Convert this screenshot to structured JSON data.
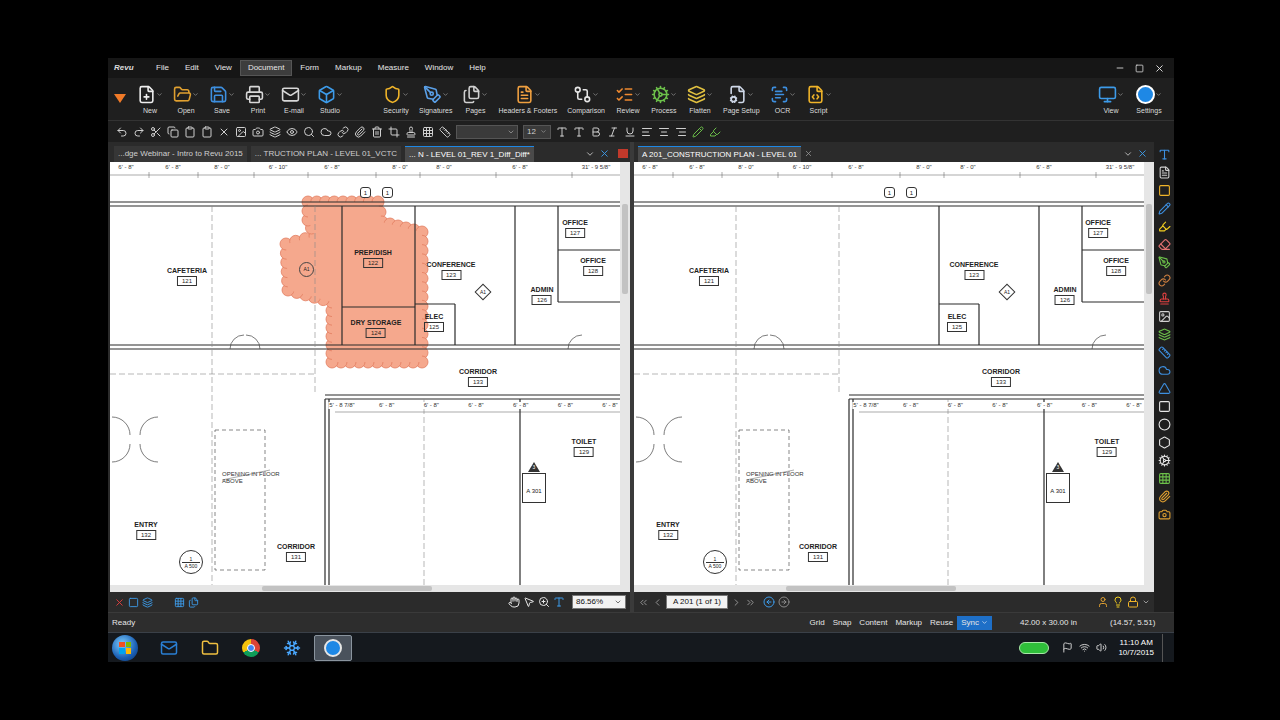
{
  "window": {
    "logo": "Revu"
  },
  "menu": [
    {
      "label": "File",
      "selected": false
    },
    {
      "label": "Edit",
      "selected": false
    },
    {
      "label": "View",
      "selected": false
    },
    {
      "label": "Document",
      "selected": true
    },
    {
      "label": "Form",
      "selected": false
    },
    {
      "label": "Markup",
      "selected": false
    },
    {
      "label": "Measure",
      "selected": false
    },
    {
      "label": "Window",
      "selected": false
    },
    {
      "label": "Help",
      "selected": false
    }
  ],
  "toolbar_groups": [
    [
      "New",
      "Open",
      "Save",
      "Print",
      "E-mail",
      "Studio"
    ],
    [
      "Security",
      "Signatures",
      "Pages",
      "Headers & Footers",
      "Comparison",
      "Review",
      "Process",
      "Flatten",
      "Page Setup",
      "OCR",
      "Script"
    ]
  ],
  "toolbar_right": [
    "View",
    "Settings"
  ],
  "format_bar": {
    "size": "12"
  },
  "left_pane": {
    "tabs": [
      {
        "label": "...dge Webinar - Intro to Revu 2015",
        "selected": false
      },
      {
        "label": "... TRUCTION PLAN - LEVEL 01_VCTC",
        "selected": false
      },
      {
        "label": "... N - LEVEL 01_REV 1_Diff_Diff*",
        "selected": true
      }
    ],
    "zoom": "86.56%",
    "plan": {
      "rooms": [
        {
          "name": "CAFETERIA",
          "number": "121"
        },
        {
          "name": "PREP/DISH",
          "number": "122"
        },
        {
          "name": "CONFERENCE",
          "number": "123"
        },
        {
          "name": "OFFICE",
          "number": "127"
        },
        {
          "name": "OFFICE",
          "number": "128"
        },
        {
          "name": "ADMIN",
          "number": "126"
        },
        {
          "name": "ELEC",
          "number": "125"
        },
        {
          "name": "DRY STORAGE",
          "number": "124"
        },
        {
          "name": "CORRIDOR",
          "number": "133"
        },
        {
          "name": "TOILET",
          "number": "129"
        },
        {
          "name": "ENTRY",
          "number": "132"
        },
        {
          "name": "CORRIDOR",
          "number": "131"
        }
      ],
      "dimensions_top": [
        "6' - 8\"",
        "6' - 8\"",
        "8' - 0\"",
        "6' - 10\"",
        "6' - 8\"",
        "8' - 0\"",
        "8' - 0\"",
        "6' - 8\"",
        "31' - 9 5/8\""
      ],
      "dimensions_corridor": [
        "5' - 8 7/8\"",
        "6' - 8\"",
        "6' - 8\"",
        "6' - 8\"",
        "6' - 8\"",
        "6' - 8\"",
        "6' - 8\""
      ],
      "grid_tags": [
        "1",
        "1"
      ],
      "keynote": "A1",
      "note": "OPENING IN FLOOR ABOVE",
      "section_tag": {
        "number": "3",
        "sheet": "A 301"
      },
      "detail_tag": {
        "number": "1",
        "sheet": "A 500"
      },
      "revision_cloud": {
        "visible": true,
        "tag": "A1"
      }
    }
  },
  "right_pane": {
    "tabs": [
      {
        "label": "A 201_CONSTRUCTION PLAN - LEVEL 01",
        "selected": true
      }
    ],
    "page": "A 201 (1 of 1)",
    "plan": {
      "rooms": [
        {
          "name": "CAFETERIA",
          "number": "121"
        },
        {
          "name": "CONFERENCE",
          "number": "123"
        },
        {
          "name": "OFFICE",
          "number": "127"
        },
        {
          "name": "OFFICE",
          "number": "128"
        },
        {
          "name": "ADMIN",
          "number": "126"
        },
        {
          "name": "ELEC",
          "number": "125"
        },
        {
          "name": "CORRIDOR",
          "number": "133"
        },
        {
          "name": "TOILET",
          "number": "129"
        },
        {
          "name": "ENTRY",
          "number": "132"
        },
        {
          "name": "CORRIDOR",
          "number": "131"
        }
      ],
      "dimensions_top": [
        "6' - 8\"",
        "6' - 8\"",
        "8' - 0\"",
        "6' - 10\"",
        "6' - 8\"",
        "8' - 0\"",
        "8' - 0\"",
        "6' - 8\"",
        "31' - 9 5/8\""
      ],
      "dimensions_corridor": [
        "5' - 8 7/8\"",
        "6' - 8\"",
        "6' - 8\"",
        "6' - 8\"",
        "6' - 8\"",
        "6' - 8\"",
        "6' - 8\""
      ],
      "grid_tags": [
        "1",
        "1"
      ],
      "keynote": "A1",
      "note": "OPENING IN FLOOR ABOVE",
      "section_tag": {
        "number": "3",
        "sheet": "A 301"
      },
      "detail_tag": {
        "number": "1",
        "sheet": "A 500"
      },
      "revision_cloud": {
        "visible": false
      }
    }
  },
  "status_bar": {
    "message": "Ready",
    "toggles": [
      {
        "label": "Grid",
        "on": false
      },
      {
        "label": "Snap",
        "on": false
      },
      {
        "label": "Content",
        "on": false
      },
      {
        "label": "Markup",
        "on": false
      },
      {
        "label": "Reuse",
        "on": false
      },
      {
        "label": "Sync",
        "on": true
      }
    ],
    "page_size": "42.00 x 30.00 in",
    "cursor": "(14.57, 5.51)"
  },
  "taskbar": {
    "apps": [
      {
        "selected": false
      },
      {
        "selected": false
      },
      {
        "selected": false
      },
      {
        "selected": false
      },
      {
        "selected": true
      }
    ],
    "time": "11:10 AM",
    "date": "10/7/2015"
  }
}
